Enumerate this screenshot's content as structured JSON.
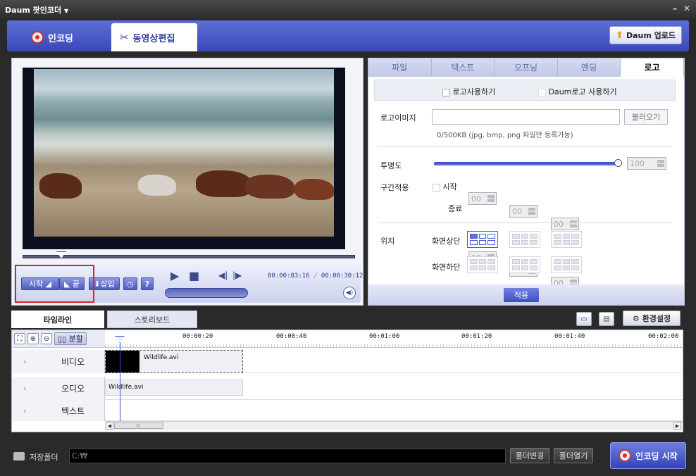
{
  "window": {
    "title": "Daum 팟인코더",
    "title_arrow": "▼",
    "minimize": "–",
    "close": "✕"
  },
  "main_tabs": [
    {
      "label": "인코딩"
    },
    {
      "label": "동영상편집"
    }
  ],
  "upload_button": "Daum 업로드",
  "player": {
    "start_btn": "시작",
    "end_btn": "끝",
    "insert_btn": "삽입",
    "help_btn": "?",
    "current_time": "00:00:03:16",
    "total_time": "00:00:30:12",
    "time_sep": " / "
  },
  "right_tabs": [
    {
      "label": "파일"
    },
    {
      "label": "텍스트"
    },
    {
      "label": "오프닝"
    },
    {
      "label": "엔딩"
    },
    {
      "label": "로고"
    }
  ],
  "logo": {
    "use_logo": "로고사용하기",
    "use_daum_logo": "Daum로고 사용하기",
    "image_label": "로고이미지",
    "load_button": "불러오기",
    "size_used": "0",
    "size_hint": "/500KB (jpg, bmp, png 파일만 등록가능)",
    "opacity_label": "투명도",
    "opacity_value": "100",
    "range_label": "구간적용",
    "start_label": "시작",
    "end_label": "종료",
    "spin_value": "00",
    "position_label": "위치",
    "top_label": "화면상단",
    "bottom_label": "화면하단",
    "apply_button": "적용"
  },
  "timeline": {
    "tab_timeline": "타임라인",
    "tab_storyboard": "스토리보드",
    "settings_button": "환경설정",
    "split_button": "분할",
    "ticks": [
      "00:00:20",
      "00:00:40",
      "00:01:00",
      "00:01:20",
      "00:01:40",
      "00:02:00"
    ],
    "tracks": [
      {
        "label": "비디오"
      },
      {
        "label": "오디오"
      },
      {
        "label": "텍스트"
      }
    ],
    "chevron": "›",
    "video_clip": "Wildlife.avi",
    "audio_clip": "Wildlife.avi",
    "scroll_mark": "III"
  },
  "bottom": {
    "save_folder_label": "저장폴더",
    "path": "C:₩",
    "change_folder": "폴더변경",
    "open_folder": "폴더열기",
    "encode_start": "인코딩 시작"
  }
}
